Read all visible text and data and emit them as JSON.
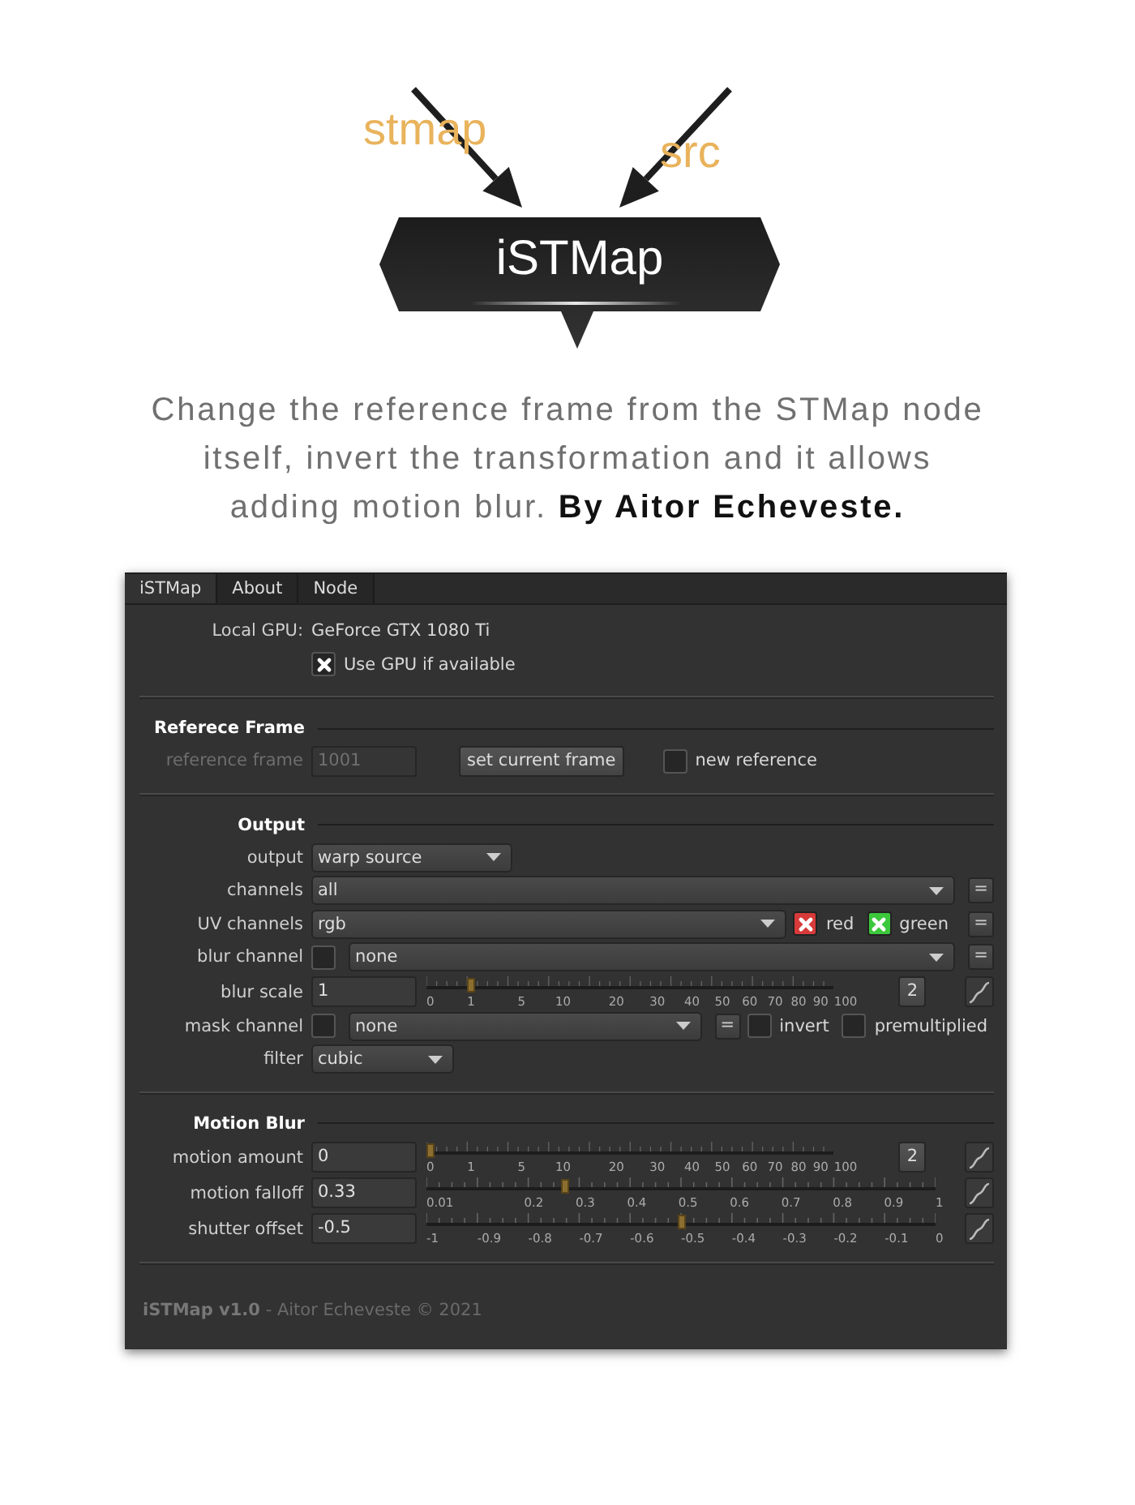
{
  "node_graph": {
    "node": "iSTMap",
    "inputs": [
      {
        "label": "stmap"
      },
      {
        "label": "src"
      }
    ]
  },
  "description": "Change the reference frame from the STMap node\nitself, invert the transformation and it allows\nadding motion blur. **By Aitor Echeveste.**",
  "panel": {
    "tabs": [
      {
        "label": "iSTMap",
        "selected": true
      },
      {
        "label": "About",
        "selected": false
      },
      {
        "label": "Node",
        "selected": false
      }
    ],
    "sections": [
      {
        "rows": [
          {
            "label": "Local GPU:",
            "controls": [
              {
                "kind": "text",
                "text": "GeForce GTX 1080 Ti"
              }
            ]
          },
          {
            "controls": [
              {
                "kind": "checkbox",
                "label": "Use GPU if available",
                "checked": true
              }
            ]
          }
        ]
      },
      {
        "title": "Referece Frame",
        "rows": [
          {
            "label": "reference frame",
            "disabled": true,
            "controls": [
              {
                "kind": "input",
                "value": "1001"
              },
              {
                "kind": "button",
                "text": "set current frame"
              },
              {
                "kind": "checkbox",
                "label": "new reference",
                "checked": false
              }
            ]
          }
        ]
      },
      {
        "title": "Output",
        "rows": [
          {
            "label": "output",
            "controls": [
              {
                "kind": "dropdown",
                "value": "warp source"
              }
            ]
          },
          {
            "label": "channels",
            "controls": [
              {
                "kind": "dropdown",
                "value": "all"
              },
              {
                "kind": "link",
                "text": "="
              }
            ]
          },
          {
            "label": "UV channels",
            "controls": [
              {
                "kind": "dropdown",
                "value": "rgb"
              },
              {
                "kind": "checkbox",
                "label": "red",
                "checked": true,
                "color": "#d83a3a"
              },
              {
                "kind": "checkbox",
                "label": "green",
                "checked": true,
                "color": "#3cc83c"
              },
              {
                "kind": "link",
                "text": "="
              }
            ]
          },
          {
            "label": "blur channel",
            "controls": [
              {
                "kind": "checkbox",
                "checked": false
              },
              {
                "kind": "dropdown",
                "value": "none"
              },
              {
                "kind": "link",
                "text": "="
              }
            ]
          },
          {
            "label": "blur scale",
            "controls": [
              {
                "kind": "input",
                "value": "1"
              },
              {
                "kind": "slider",
                "level": 0.1,
                "ticks": [
                  "0",
                  "1",
                  "5",
                  "10",
                  "20",
                  "30",
                  "40",
                  "50",
                  "60",
                  "70",
                  "80",
                  "90",
                  "100"
                ]
              },
              {
                "kind": "button",
                "text": "2"
              },
              {
                "kind": "curve"
              }
            ]
          },
          {
            "label": "mask channel",
            "controls": [
              {
                "kind": "checkbox",
                "checked": false
              },
              {
                "kind": "dropdown",
                "value": "none"
              },
              {
                "kind": "link",
                "text": "="
              },
              {
                "kind": "checkbox",
                "label": "invert",
                "checked": false
              },
              {
                "kind": "checkbox",
                "label": "premultiplied",
                "checked": false
              }
            ]
          },
          {
            "label": "filter",
            "controls": [
              {
                "kind": "dropdown",
                "value": "cubic"
              }
            ]
          }
        ]
      },
      {
        "title": "Motion Blur",
        "rows": [
          {
            "label": "motion amount",
            "controls": [
              {
                "kind": "input",
                "value": "0"
              },
              {
                "kind": "slider",
                "level": 0,
                "ticks": [
                  "0",
                  "1",
                  "5",
                  "10",
                  "20",
                  "30",
                  "40",
                  "50",
                  "60",
                  "70",
                  "80",
                  "90",
                  "100"
                ]
              },
              {
                "kind": "button",
                "text": "2"
              },
              {
                "kind": "curve"
              }
            ]
          },
          {
            "label": "motion falloff",
            "controls": [
              {
                "kind": "input",
                "value": "0.33"
              },
              {
                "kind": "slider",
                "level": 0.27,
                "ticks": [
                  "0.01",
                  "0.2",
                  "0.3",
                  "0.4",
                  "0.5",
                  "0.6",
                  "0.7",
                  "0.8",
                  "0.9",
                  "1"
                ]
              },
              {
                "kind": "curve"
              }
            ]
          },
          {
            "label": "shutter offset",
            "controls": [
              {
                "kind": "input",
                "value": "-0.5"
              },
              {
                "kind": "slider",
                "level": 0.5,
                "ticks": [
                  "-1",
                  "-0.9",
                  "-0.8",
                  "-0.7",
                  "-0.6",
                  "-0.5",
                  "-0.4",
                  "-0.3",
                  "-0.2",
                  "-0.1",
                  "0"
                ]
              },
              {
                "kind": "curve"
              }
            ]
          }
        ]
      }
    ],
    "footer": "**iSTMap v1.0** - Aitor Echeveste © 2021"
  }
}
